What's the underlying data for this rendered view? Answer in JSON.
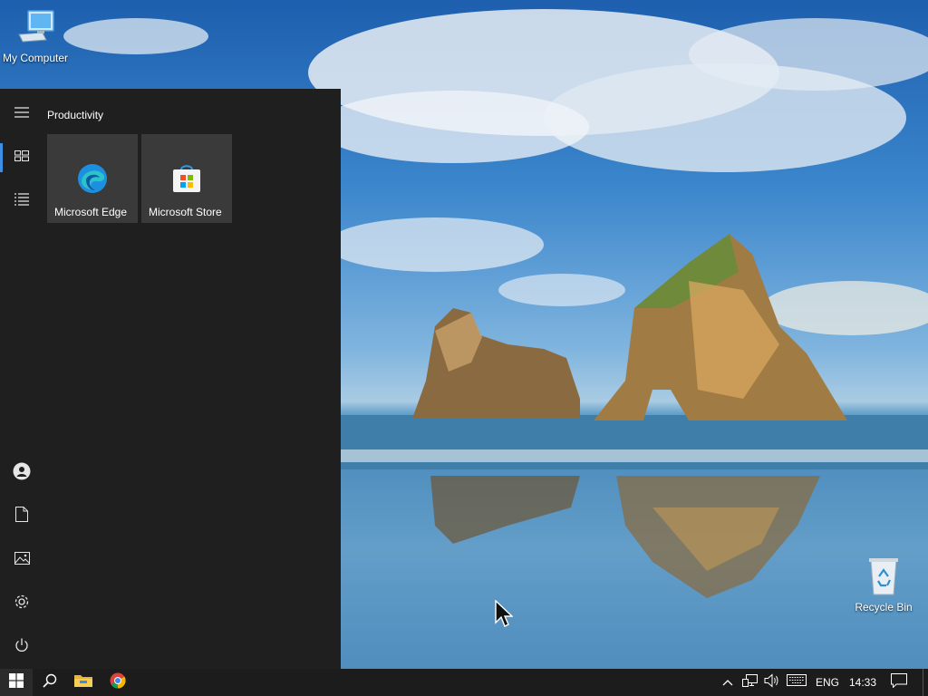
{
  "desktop": {
    "icons": [
      {
        "label": "My Computer",
        "icon": "computer-icon"
      },
      {
        "label": "Recycle Bin",
        "icon": "recycle-bin-icon"
      }
    ]
  },
  "start_menu": {
    "rail": {
      "top": [
        {
          "name": "menu-expand",
          "icon": "hamburger-icon"
        },
        {
          "name": "pinned-tiles",
          "icon": "tiles-icon",
          "active": true
        },
        {
          "name": "all-apps",
          "icon": "list-icon"
        }
      ],
      "bottom": [
        {
          "name": "account",
          "icon": "user-icon"
        },
        {
          "name": "documents",
          "icon": "document-icon"
        },
        {
          "name": "pictures",
          "icon": "picture-icon"
        },
        {
          "name": "settings",
          "icon": "gear-icon"
        },
        {
          "name": "power",
          "icon": "power-icon"
        }
      ]
    },
    "group_title": "Productivity",
    "tiles": [
      {
        "label": "Microsoft Edge",
        "icon": "edge-icon"
      },
      {
        "label": "Microsoft Store",
        "icon": "store-icon"
      }
    ]
  },
  "taskbar": {
    "pinned": [
      {
        "name": "start",
        "icon": "windows-logo-icon"
      },
      {
        "name": "search",
        "icon": "search-icon"
      },
      {
        "name": "file-explorer",
        "icon": "folder-icon"
      },
      {
        "name": "chrome",
        "icon": "chrome-icon"
      }
    ],
    "tray": {
      "language": "ENG",
      "time": "14:33"
    }
  },
  "colors": {
    "start_menu_bg": "#1f1f1f",
    "tile_bg": "#3a3a3a",
    "taskbar_bg": "#1c1c1c",
    "accent": "#3d8ee6"
  }
}
